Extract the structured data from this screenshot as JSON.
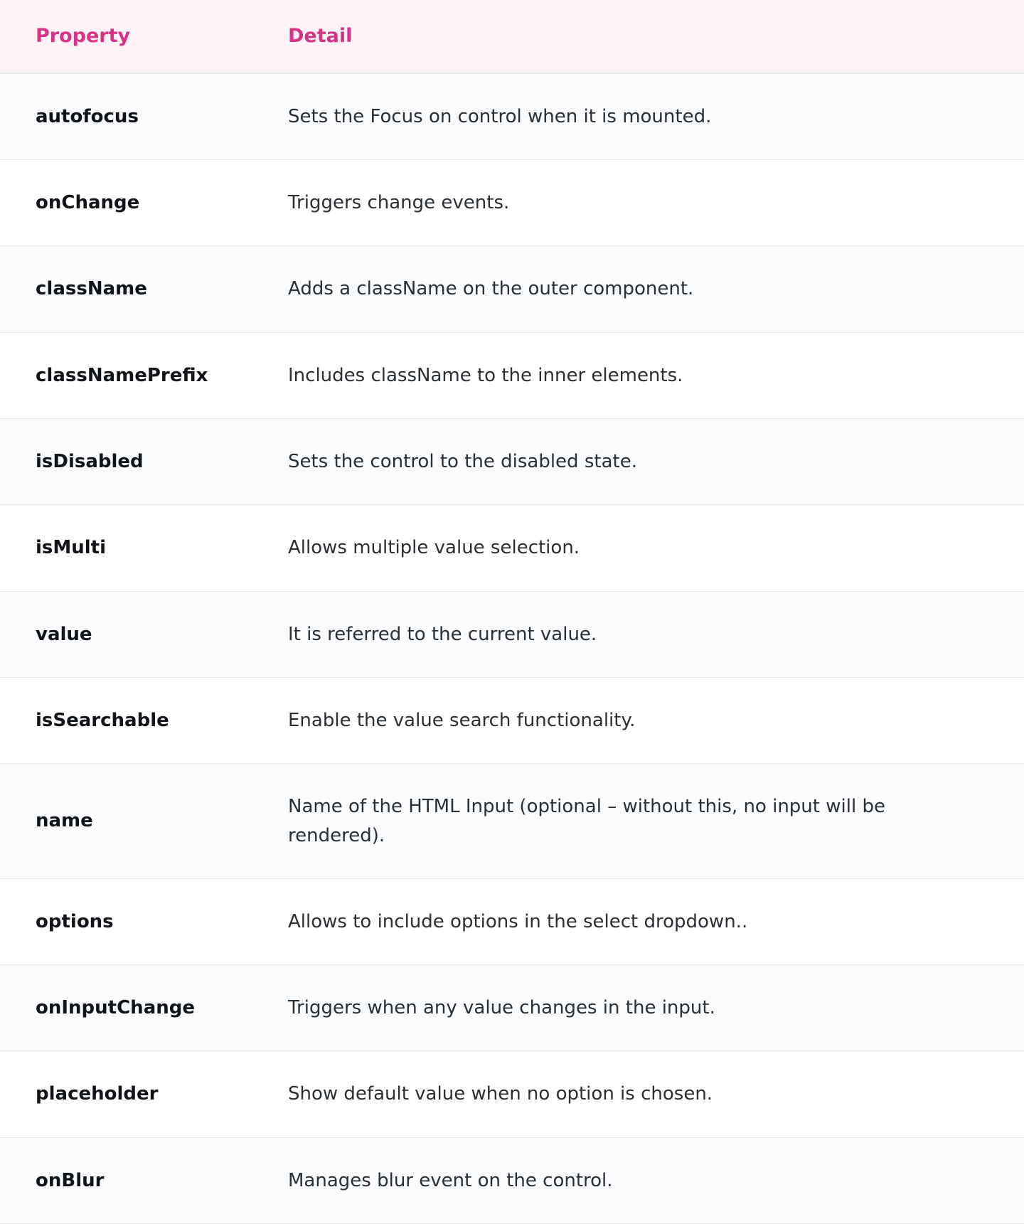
{
  "colors": {
    "accent": "#d63384",
    "header_bg": "#fdf2f6"
  },
  "table": {
    "header": {
      "property": "Property",
      "detail": "Detail"
    },
    "rows": [
      {
        "property": "autofocus",
        "detail": "Sets the Focus on control when it is mounted."
      },
      {
        "property": "onChange",
        "detail": "Triggers change events."
      },
      {
        "property": "className",
        "detail": "Adds a className on the outer component."
      },
      {
        "property": "classNamePrefix",
        "detail": "Includes className to the inner elements."
      },
      {
        "property": "isDisabled",
        "detail": "Sets the control to the disabled state."
      },
      {
        "property": "isMulti",
        "detail": "Allows multiple value selection."
      },
      {
        "property": "value",
        "detail": "It is referred to the current value."
      },
      {
        "property": "isSearchable",
        "detail": "Enable the value search functionality."
      },
      {
        "property": "name",
        "detail": "Name of the HTML Input (optional – without this, no input will be rendered)."
      },
      {
        "property": "options",
        "detail": "Allows to include options in the select dropdown.."
      },
      {
        "property": "onInputChange",
        "detail": "Triggers when any value changes in the input."
      },
      {
        "property": "placeholder",
        "detail": "Show default value when no option is chosen."
      },
      {
        "property": "onBlur",
        "detail": "Manages blur event on the control."
      }
    ]
  }
}
